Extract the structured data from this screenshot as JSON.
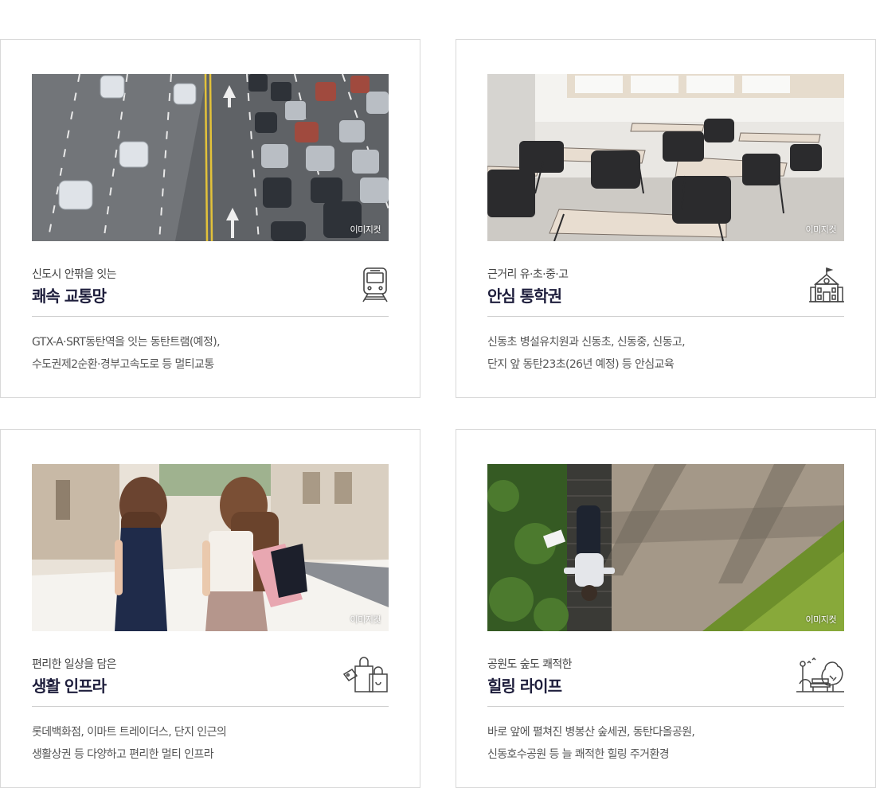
{
  "cards": [
    {
      "subtitle": "신도시 안팎을 잇는",
      "title": "쾌속 교통망",
      "desc_line1": "GTX-A·SRT동탄역을 잇는 동탄트램(예정),",
      "desc_line2": "수도권제2순환·경부고속도로 등 멀티교통",
      "photo_credit": "이미지컷",
      "icon": "tram-icon"
    },
    {
      "subtitle": "근거리 유·초·중·고",
      "title": "안심 통학권",
      "desc_line1": "신동초 병설유치원과 신동초, 신동중, 신동고,",
      "desc_line2": "단지 앞 동탄23초(26년 예정) 등 안심교육",
      "photo_credit": "이미지컷",
      "icon": "school-building-icon"
    },
    {
      "subtitle": "편리한 일상을 담은",
      "title": "생활 인프라",
      "desc_line1": "롯데백화점, 이마트 트레이더스, 단지 인근의",
      "desc_line2": "생활상권 등 다양하고 편리한 멀티 인프라",
      "photo_credit": "이미지컷",
      "icon": "shopping-bags-icon"
    },
    {
      "subtitle": "공원도 숲도 쾌적한",
      "title": "힐링 라이프",
      "desc_line1": "바로 앞에 펼쳐진 병봉산 숲세권, 동탄다올공원,",
      "desc_line2": "신동호수공원 등 늘 쾌적한 힐링 주거환경",
      "photo_credit": "이미지컷",
      "icon": "park-bench-icon"
    }
  ]
}
